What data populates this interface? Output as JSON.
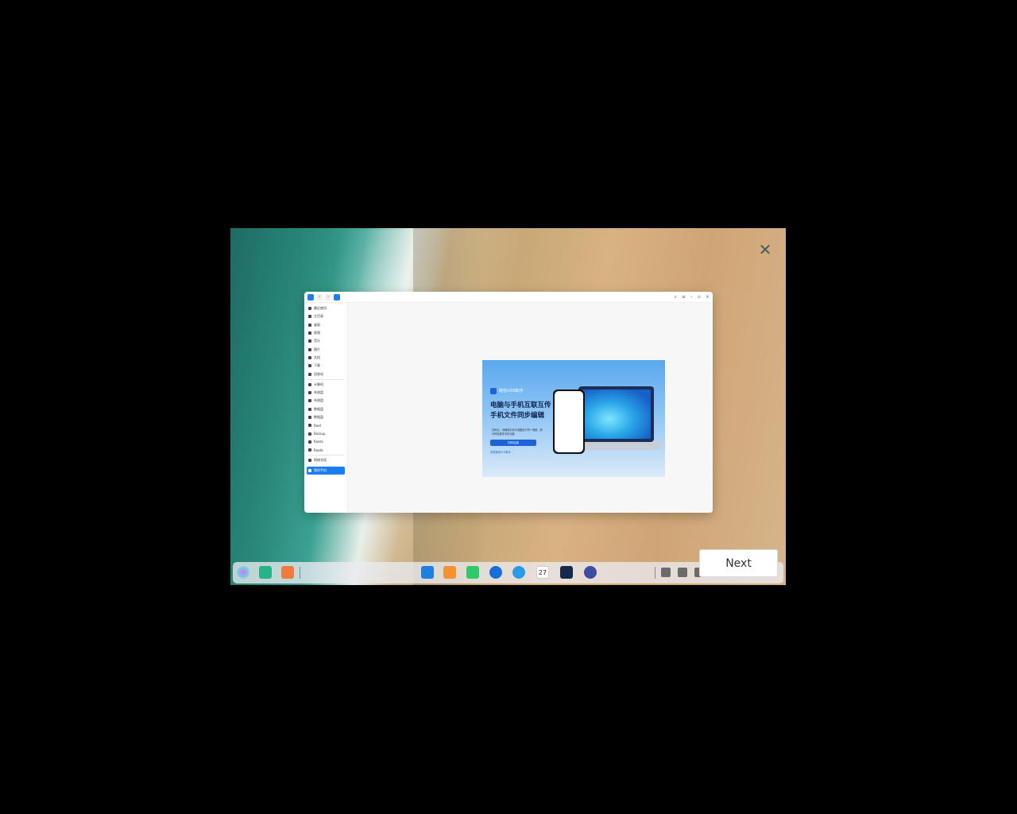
{
  "overlay": {
    "close_icon": "close-icon",
    "next_label": "Next"
  },
  "window": {
    "sidebar": {
      "items": [
        "最近使用",
        "主目录",
        "桌面",
        "视频",
        "音乐",
        "图片",
        "文档",
        "下载",
        "回收站"
      ],
      "devices": [
        "计算机",
        "系统盘",
        "系统盘",
        "数据盘",
        "数据盘",
        "Root",
        "Backup",
        "Roota",
        "Rootb"
      ],
      "network": [
        "网络邻居"
      ],
      "phone": "我的手机"
    },
    "banner": {
      "brand": "统信UOS助手",
      "title1": "电脑与手机互联互传",
      "title2": "手机文件同步编辑",
      "desc": "扫码后，请确保手机与电脑处于同一网络，即可体验更多手机功能",
      "button": "扫码连接",
      "link": "查看使用UOS助手"
    }
  },
  "dock": {
    "left_icons": [
      "launcher-icon",
      "multitask-icon",
      "desktop-icon"
    ],
    "center_icons": [
      "file-manager-icon",
      "app-store-icon",
      "music-icon",
      "security-icon",
      "browser-icon",
      "calendar-icon",
      "deepin-icon",
      "settings-icon"
    ],
    "calendar_day": "27",
    "tray_icons": [
      "volume-icon",
      "network-icon",
      "notification-icon"
    ]
  }
}
